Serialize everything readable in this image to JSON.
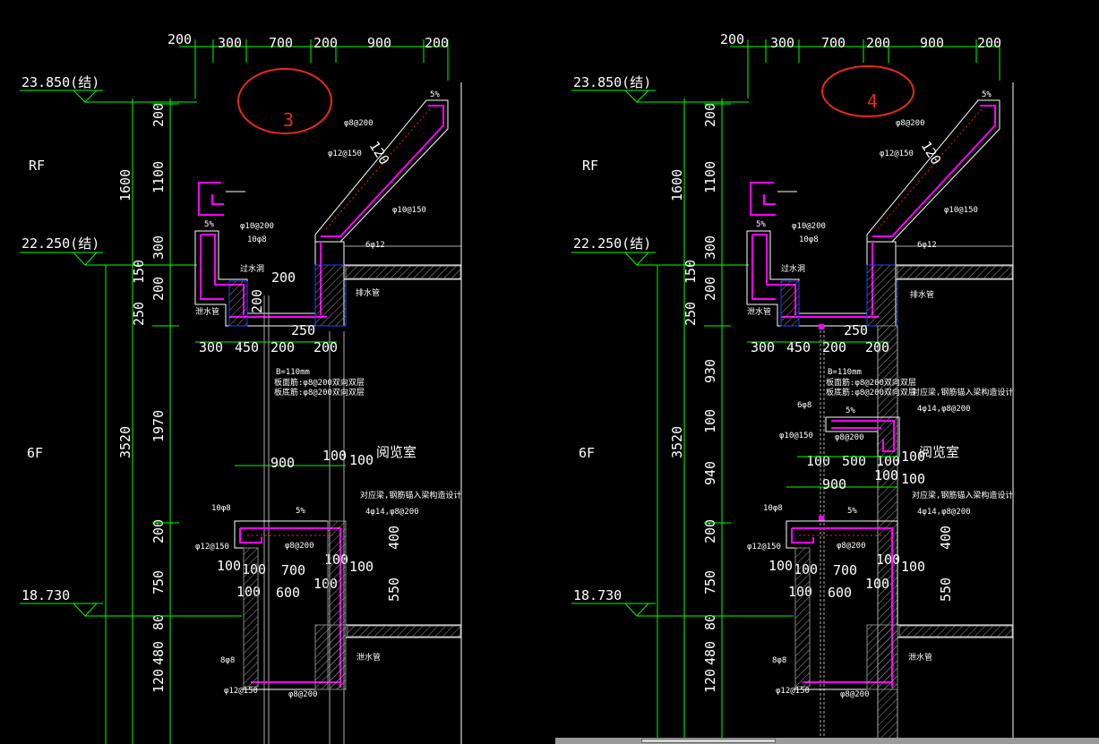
{
  "panels": [
    {
      "id": "left",
      "marker_number": "3",
      "top_dims": [
        "200",
        "300",
        "700",
        "200",
        "900",
        "200"
      ],
      "level_top": "23.850(结)",
      "level_mid": "22.250(结)",
      "level_low": "18.730",
      "floor_rf": "RF",
      "floor_6f": "6F",
      "left_dims_outer": [
        "1600",
        "3520"
      ],
      "left_dims_inner_upper": [
        "200",
        "1100",
        "300",
        "150",
        "200",
        "250"
      ],
      "left_dims_inner_lower": [
        "1970",
        "200",
        "750",
        "80",
        "480",
        "120"
      ],
      "parapet_dims": [
        "120"
      ],
      "gutter_dims": [
        "300",
        "450",
        "200",
        "200",
        "250",
        "200",
        "200"
      ],
      "slab_note": [
        "B=110mm",
        "板面筋:φ8@200双向双层",
        "板底筋:φ8@200双向双层"
      ],
      "rebar_labels": [
        "φ8@200",
        "φ12@150",
        "φ10@150",
        "φ10@200",
        "10φ8",
        "6φ12",
        "5%",
        "5%"
      ],
      "room_name": "阅览室",
      "lower_dims": [
        "900",
        "100",
        "100",
        "400",
        "550",
        "700",
        "600",
        "100",
        "100",
        "100",
        "100",
        "100",
        "100"
      ],
      "lower_rebar": [
        "10φ8",
        "5%",
        "φ12@150",
        "φ8@200",
        "8φ8",
        "φ12@150",
        "φ8@200"
      ],
      "lower_note": [
        "对应梁,钢筋锚入梁构造设计",
        "4φ14,φ8@200"
      ],
      "small_notes": [
        "过水洞",
        "排水管",
        "泄水管",
        "泄水管"
      ]
    },
    {
      "id": "right",
      "marker_number": "4",
      "top_dims": [
        "200",
        "300",
        "700",
        "200",
        "900",
        "200"
      ],
      "level_top": "23.850(结)",
      "level_mid": "22.250(结)",
      "level_low": "18.730",
      "floor_rf": "RF",
      "floor_6f": "6F",
      "left_dims_outer": [
        "1600",
        "3520"
      ],
      "left_dims_inner_upper": [
        "200",
        "1100",
        "300",
        "150",
        "200",
        "250"
      ],
      "left_dims_inner_lower": [
        "930",
        "100",
        "940",
        "200",
        "750",
        "80",
        "480",
        "120"
      ],
      "parapet_dims": [
        "120"
      ],
      "gutter_dims": [
        "300",
        "450",
        "200",
        "200",
        "250"
      ],
      "slab_note": [
        "B=110mm",
        "板面筋:φ8@200双向双层",
        "板底筋:φ8@200双向双层"
      ],
      "rebar_labels": [
        "φ8@200",
        "φ12@150",
        "φ10@150",
        "φ10@200",
        "10φ8",
        "6φ12",
        "5%",
        "5%"
      ],
      "room_name": "阅览室",
      "mid_labels": [
        "6φ8",
        "φ10@150",
        "φ8@200",
        "5%",
        "100",
        "500",
        "100",
        "100"
      ],
      "mid_note": [
        "对应梁,钢筋锚入梁构造设计",
        "4φ14,φ8@200"
      ],
      "lower_dims": [
        "900",
        "100",
        "100",
        "400",
        "550",
        "700",
        "600",
        "100",
        "100",
        "100",
        "100",
        "100",
        "100"
      ],
      "lower_rebar": [
        "10φ8",
        "5%",
        "φ12@150",
        "φ8@200",
        "8φ8",
        "φ12@150",
        "φ8@200"
      ],
      "lower_note": [
        "对应梁,钢筋锚入梁构造设计",
        "4φ14,φ8@200"
      ],
      "small_notes": [
        "过水洞",
        "排水管",
        "泄水管",
        "泄水管"
      ]
    }
  ]
}
